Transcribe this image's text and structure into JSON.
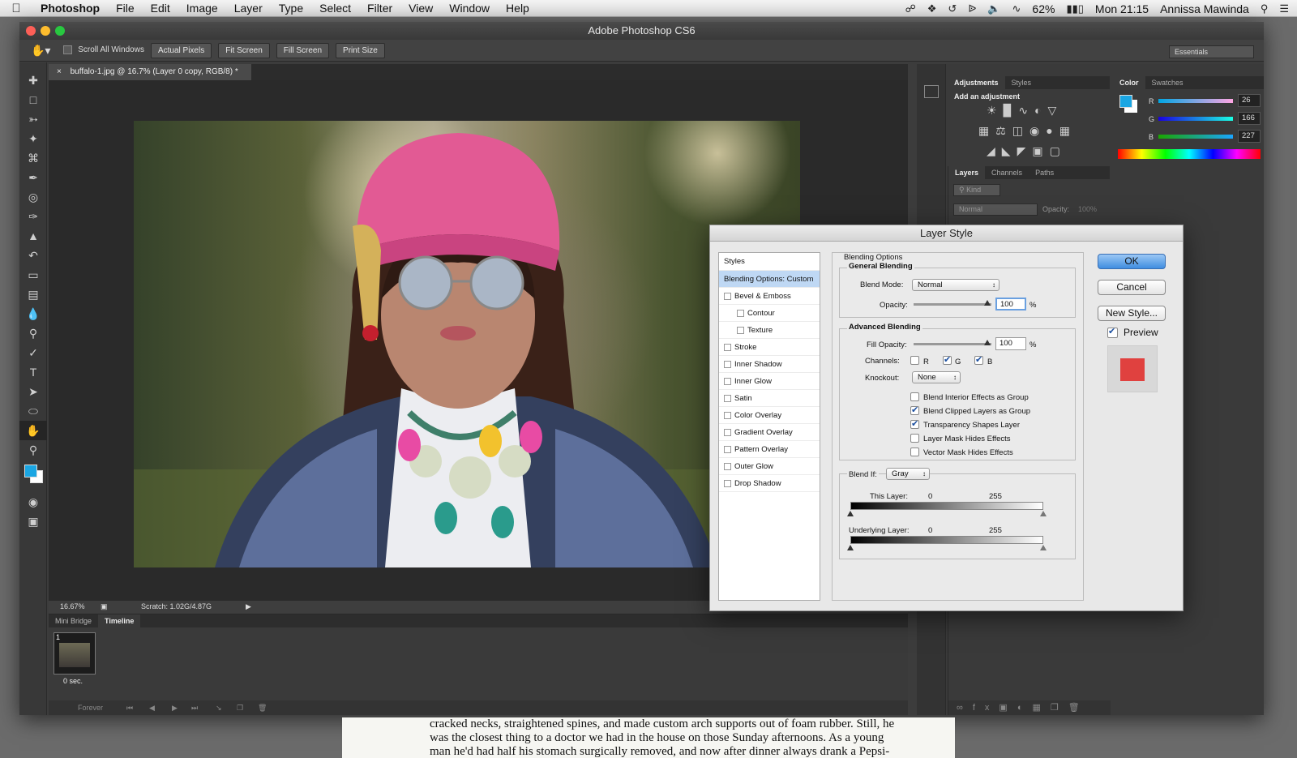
{
  "menubar": {
    "app": "Photoshop",
    "items": [
      "File",
      "Edit",
      "Image",
      "Layer",
      "Type",
      "Select",
      "Filter",
      "View",
      "Window",
      "Help"
    ],
    "battery": "62%",
    "clock": "Mon 21:15",
    "user": "Annissa Mawinda"
  },
  "window": {
    "title": "Adobe Photoshop CS6"
  },
  "options_bar": {
    "scroll_all": "Scroll All Windows",
    "actual_pixels": "Actual Pixels",
    "fit_screen": "Fit Screen",
    "fill_screen": "Fill Screen",
    "print_size": "Print Size",
    "workspace": "Essentials"
  },
  "document": {
    "tab_title": "buffalo-1.jpg @ 16.7% (Layer 0 copy, RGB/8) *",
    "zoom": "16.67%",
    "scratch": "Scratch: 1.02G/4.87G"
  },
  "bottom_panel": {
    "tabs": [
      "Mini Bridge",
      "Timeline"
    ],
    "frame_number": "1",
    "frame_delay": "0 sec.",
    "loop": "Forever"
  },
  "adjustments_panel": {
    "tabs": [
      "Adjustments",
      "Styles"
    ],
    "heading": "Add an adjustment"
  },
  "color_panel": {
    "tabs": [
      "Color",
      "Swatches"
    ],
    "r_label": "R",
    "g_label": "G",
    "b_label": "B",
    "r": "26",
    "g": "166",
    "b": "227",
    "fg_color": "#1aa6e3"
  },
  "layers_panel": {
    "tabs": [
      "Layers",
      "Channels",
      "Paths"
    ],
    "filter": "Kind",
    "blend": "Normal",
    "opacity_label": "Opacity:",
    "opacity": "100%"
  },
  "dialog": {
    "title": "Layer Style",
    "styles_header": "Styles",
    "style_items": [
      {
        "label": "Blending Options: Custom",
        "selected": true,
        "checkbox": false,
        "indent": false
      },
      {
        "label": "Bevel & Emboss",
        "checkbox": true,
        "indent": false
      },
      {
        "label": "Contour",
        "checkbox": true,
        "indent": true
      },
      {
        "label": "Texture",
        "checkbox": true,
        "indent": true
      },
      {
        "label": "Stroke",
        "checkbox": true,
        "indent": false
      },
      {
        "label": "Inner Shadow",
        "checkbox": true,
        "indent": false
      },
      {
        "label": "Inner Glow",
        "checkbox": true,
        "indent": false
      },
      {
        "label": "Satin",
        "checkbox": true,
        "indent": false
      },
      {
        "label": "Color Overlay",
        "checkbox": true,
        "indent": false
      },
      {
        "label": "Gradient Overlay",
        "checkbox": true,
        "indent": false
      },
      {
        "label": "Pattern Overlay",
        "checkbox": true,
        "indent": false
      },
      {
        "label": "Outer Glow",
        "checkbox": true,
        "indent": false
      },
      {
        "label": "Drop Shadow",
        "checkbox": true,
        "indent": false
      }
    ],
    "blending_options": "Blending Options",
    "general_blending": "General Blending",
    "blend_mode_label": "Blend Mode:",
    "blend_mode": "Normal",
    "opacity_label": "Opacity:",
    "opacity": "100",
    "percent": "%",
    "advanced_blending": "Advanced Blending",
    "fill_opacity_label": "Fill Opacity:",
    "fill_opacity": "100",
    "channels_label": "Channels:",
    "channel_r": "R",
    "channel_g": "G",
    "channel_b": "B",
    "knockout_label": "Knockout:",
    "knockout": "None",
    "options": [
      {
        "label": "Blend Interior Effects as Group",
        "checked": false
      },
      {
        "label": "Blend Clipped Layers as Group",
        "checked": true
      },
      {
        "label": "Transparency Shapes Layer",
        "checked": true
      },
      {
        "label": "Layer Mask Hides Effects",
        "checked": false
      },
      {
        "label": "Vector Mask Hides Effects",
        "checked": false
      }
    ],
    "blend_if_label": "Blend If:",
    "blend_if": "Gray",
    "this_layer_label": "This Layer:",
    "underlying_label": "Underlying Layer:",
    "range_low": "0",
    "range_high": "255",
    "ok": "OK",
    "cancel": "Cancel",
    "new_style": "New Style...",
    "preview": "Preview",
    "preview_color": "#e0413f"
  },
  "article": {
    "lines": [
      "cracked necks, straightened spines, and made custom arch supports out of foam rubber. Still, he",
      "was the closest thing to a doctor we had in the house on those Sunday afternoons. As a young",
      "man he'd had half his stomach surgically removed, and now after dinner always drank a Pepsi-"
    ]
  }
}
